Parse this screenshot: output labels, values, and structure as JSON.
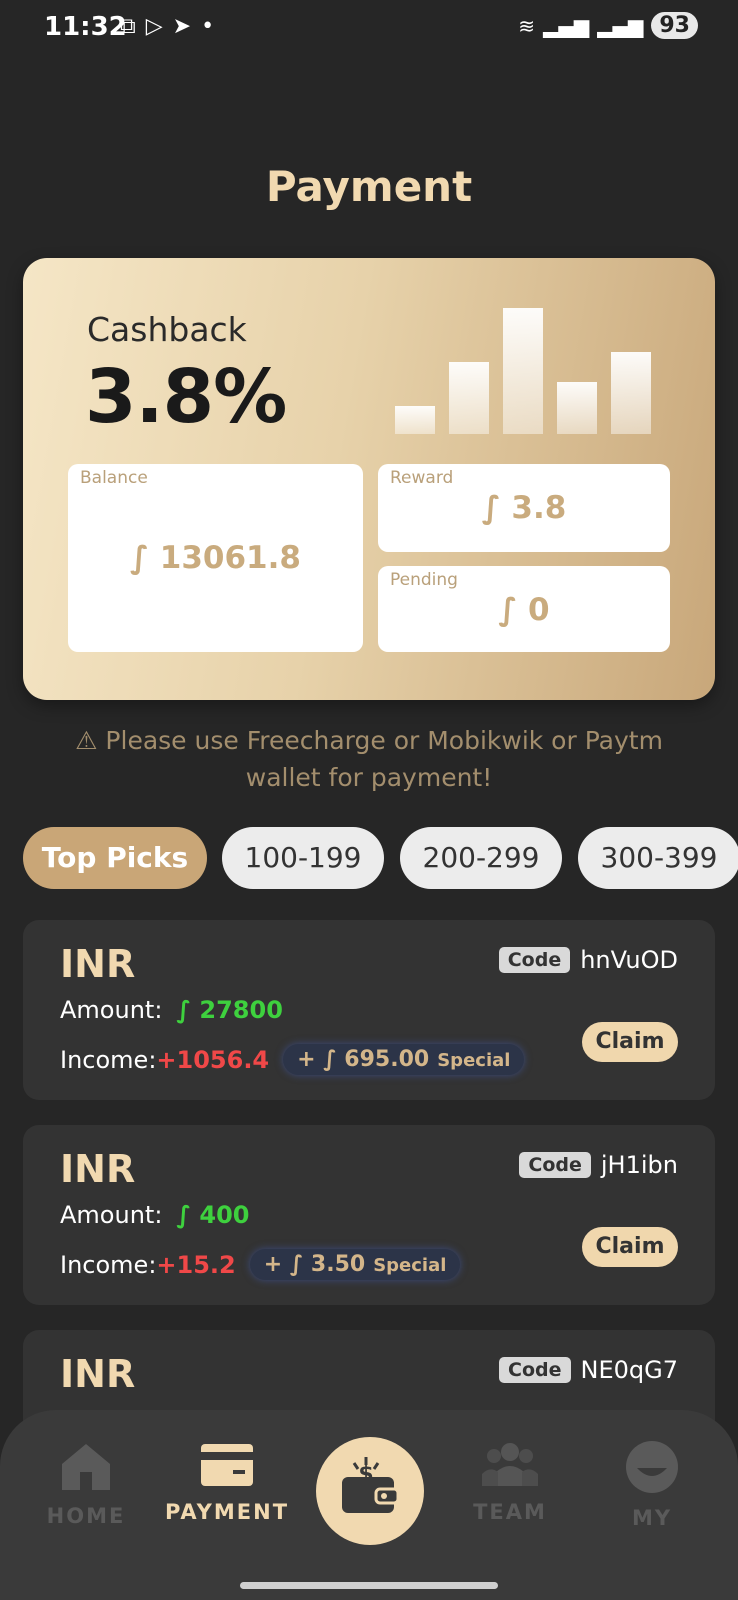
{
  "status_bar": {
    "time": "11:32",
    "battery": "93"
  },
  "page": {
    "title": "Payment"
  },
  "cashback_card": {
    "label": "Cashback",
    "value": "3.8%",
    "bar_levels": [
      0.22,
      0.57,
      1.0,
      0.41,
      0.65
    ],
    "balance": {
      "label": "Balance",
      "value": "∫ 13061.8"
    },
    "reward": {
      "label": "Reward",
      "value": "∫ 3.8"
    },
    "pending": {
      "label": "Pending",
      "value": "∫ 0"
    }
  },
  "notice": "⚠ Please use Freecharge or Mobikwik or Paytm wallet for payment!",
  "tabs": [
    {
      "label": "Top Picks",
      "active": true
    },
    {
      "label": "100-199",
      "active": false
    },
    {
      "label": "200-299",
      "active": false
    },
    {
      "label": "300-399",
      "active": false
    }
  ],
  "offers": [
    {
      "currency": "INR",
      "code_label": "Code",
      "code": "hnVuOD",
      "amount_label": "Amount:",
      "amount": "∫ 27800",
      "income_label": "Income:",
      "income": "+1056.4",
      "bonus": "+ ∫ 695.00",
      "bonus_tag": "Special",
      "claim": "Claim"
    },
    {
      "currency": "INR",
      "code_label": "Code",
      "code": "jH1ibn",
      "amount_label": "Amount:",
      "amount": "∫ 400",
      "income_label": "Income:",
      "income": "+15.2",
      "bonus": "+ ∫ 3.50",
      "bonus_tag": "Special",
      "claim": "Claim"
    },
    {
      "currency": "INR",
      "code_label": "Code",
      "code": "NE0qG7"
    }
  ],
  "nav": {
    "home": "HOME",
    "payment": "PAYMENT",
    "team": "TEAM",
    "my": "MY"
  },
  "colors": {
    "accent": "#f1d9b0",
    "amount_green": "#3ed13e",
    "income_red": "#f04848",
    "background": "#262626"
  }
}
